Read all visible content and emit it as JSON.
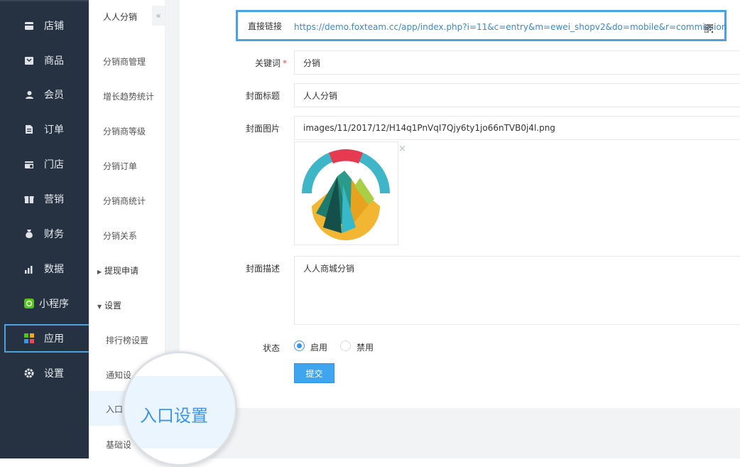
{
  "nav": {
    "items": [
      {
        "label": "店铺",
        "icon": "store-icon"
      },
      {
        "label": "商品",
        "icon": "goods-icon"
      },
      {
        "label": "会员",
        "icon": "member-icon"
      },
      {
        "label": "订单",
        "icon": "order-icon"
      },
      {
        "label": "门店",
        "icon": "shop-icon"
      },
      {
        "label": "营销",
        "icon": "gift-icon"
      },
      {
        "label": "财务",
        "icon": "money-bag-icon"
      },
      {
        "label": "数据",
        "icon": "chart-icon"
      },
      {
        "label": "小程序",
        "icon": "miniprogram-icon"
      },
      {
        "label": "应用",
        "icon": "apps-icon"
      },
      {
        "label": "设置",
        "icon": "gear-icon"
      }
    ],
    "active": "应用"
  },
  "subnav": {
    "title": "人人分销",
    "collapse_glyph": "«",
    "items": [
      {
        "label": "分销商管理"
      },
      {
        "label": "增长趋势统计"
      },
      {
        "label": "分销商等级"
      },
      {
        "label": "分销订单"
      },
      {
        "label": "分销商统计"
      },
      {
        "label": "分销关系"
      }
    ],
    "group_withdraw": "提现申请",
    "group_settings": "设置",
    "settings_items": [
      "排行榜设置",
      "通知设置",
      "入口设置",
      "基础设置"
    ],
    "settings_items_visible": [
      "排行榜设置",
      "通知设",
      "入口",
      "基础设"
    ]
  },
  "form": {
    "link_label": "直接链接",
    "link_url": "https://demo.foxteam.cc/app/index.php?i=11&c=entry&m=ewei_shopv2&do=mobile&r=commission",
    "keyword_label": "关键词",
    "keyword_required": "*",
    "keyword_value": "分销",
    "cover_title_label": "封面标题",
    "cover_title_value": "人人分销",
    "cover_image_label": "封面图片",
    "cover_image_value": "images/11/2017/12/H14q1PnVqI7Qjy6ty1jo66nTVB0j4l.png",
    "image_close": "×",
    "cover_desc_label": "封面描述",
    "cover_desc_value": "人人商城分销",
    "status_label": "状态",
    "status_options": [
      "启用",
      "禁用"
    ],
    "status_selected": "启用",
    "submit_label": "提交"
  },
  "magnifier": {
    "text": "入口设置"
  },
  "colors": {
    "nav_bg": "#263241",
    "accent": "#3d94e6",
    "highlight_border": "#4aa3df"
  }
}
